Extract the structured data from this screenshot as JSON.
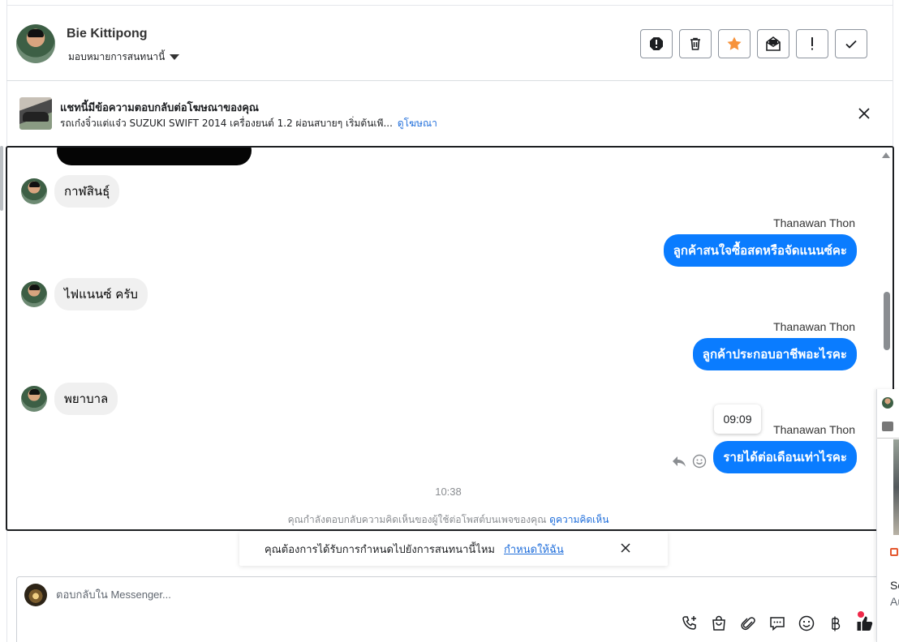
{
  "header": {
    "user_name": "Bie Kittipong",
    "assign_label": "มอบหมายการสนทนานี้",
    "actions": [
      "report-icon",
      "trash-icon",
      "star-icon",
      "mail-icon",
      "exclamation-icon",
      "check-icon"
    ]
  },
  "ad_banner": {
    "title": "แชทนี้มีข้อความตอบกลับต่อโฆษณาของคุณ",
    "subtitle": "รถเก๋งจิ๋วแต่แจ๋ว SUZUKI SWIFT 2014 เครื่องยนต์ 1.2 ผ่อนสบายๆ เริ่มต้นเพี...",
    "link": "ดูโฆษณา"
  },
  "messages": {
    "incoming_1": "กาฬสินธุ์",
    "incoming_2": "ไฟแนนซ์ ครับ",
    "incoming_3": "พยาบาล",
    "sender_1": "Thanawan Thon",
    "outgoing_1": "ลูกค้าสนใจซื้อสดหรือจัดแนนซ์คะ",
    "sender_2": "Thanawan Thon",
    "outgoing_2": "ลูกค้าประกอบอาชีพอะไรคะ",
    "sender_3": "Thanawan Thon",
    "outgoing_3": "รายได้ต่อเดือนเท่าไรคะ",
    "tooltip_time": "09:09",
    "timestamp": "10:38",
    "comment_note": "คุณกำลังตอบกลับความคิดเห็นของผู้ใช้ต่อโพสต์บนเพจของคุณ",
    "comment_link": "ดูความคิดเห็น"
  },
  "assign_toast": {
    "text": "คุณต้องการได้รับการกำหนดไปยังการสนทนานี้ไหม",
    "link": "กำหนดให้ฉัน"
  },
  "composer": {
    "placeholder": "ตอบกลับใน Messenger...",
    "tools": [
      "phone-plus-icon",
      "shopping-bag-icon",
      "paperclip-icon",
      "chat-bubble-icon",
      "emoji-icon",
      "baht-icon",
      "thumbs-up-icon"
    ]
  },
  "side_panel": {
    "text_1": "Sc",
    "text_2": "Au"
  },
  "colors": {
    "outgoing_bubble": "#0a7cff",
    "incoming_bubble": "#f0f0f0",
    "link": "#216fdb",
    "star": "#f7923a"
  }
}
